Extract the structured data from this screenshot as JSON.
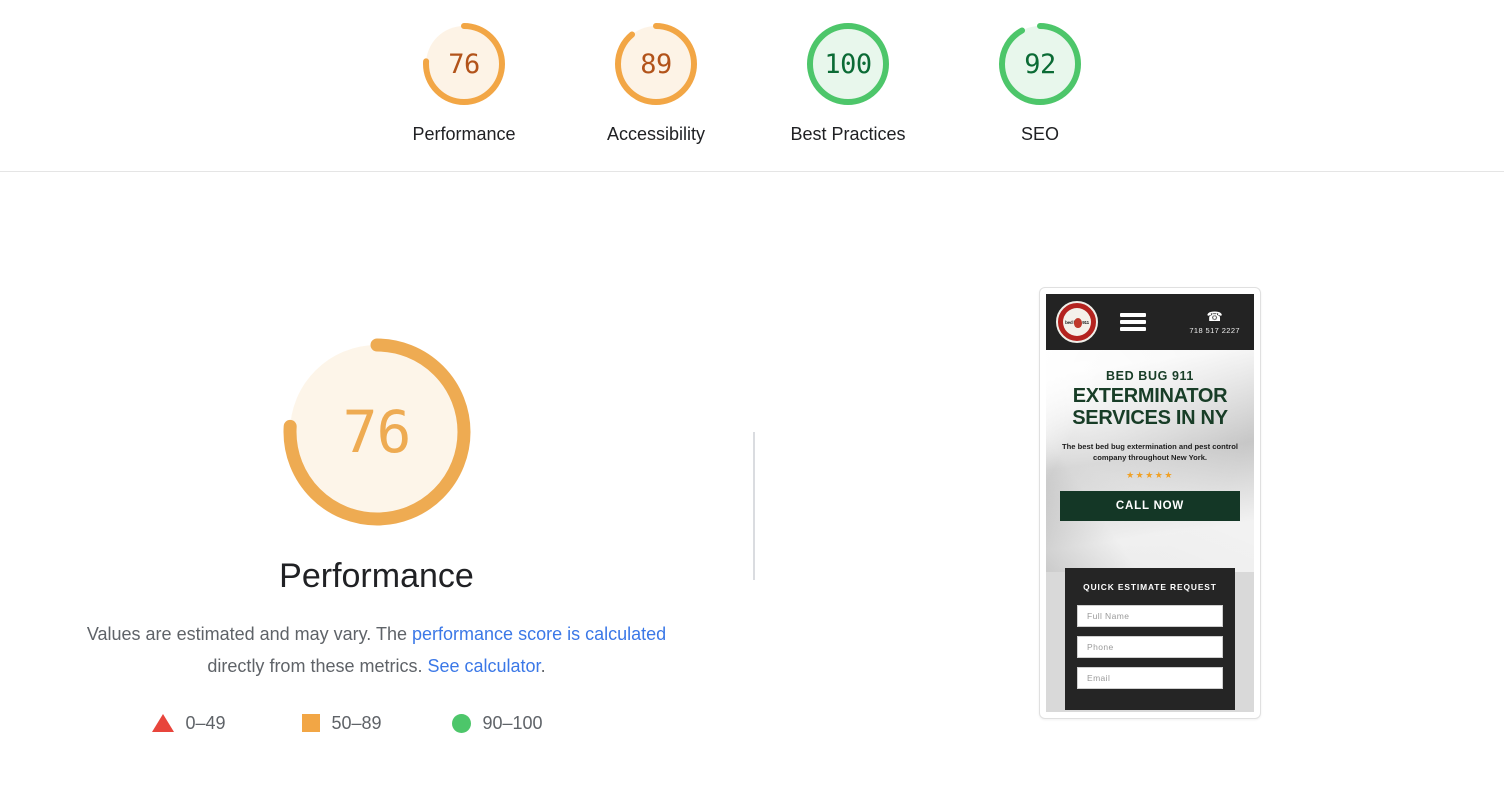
{
  "summary": {
    "gauges": [
      {
        "score": "76",
        "label": "Performance",
        "state": "average",
        "color": "#f2a645",
        "track": "#fdf3e6",
        "pct": 76
      },
      {
        "score": "89",
        "label": "Accessibility",
        "state": "average",
        "color": "#f2a645",
        "track": "#fdf3e6",
        "pct": 89
      },
      {
        "score": "100",
        "label": "Best Practices",
        "state": "pass",
        "color": "#4dc66a",
        "track": "#e8f7ec",
        "pct": 100
      },
      {
        "score": "92",
        "label": "SEO",
        "state": "pass",
        "color": "#4dc66a",
        "track": "#e8f7ec",
        "pct": 92
      }
    ]
  },
  "category": {
    "score": "76",
    "title": "Performance",
    "pct": 76,
    "arc_color": "#eeab52",
    "fill_color": "#fdf5e9",
    "description": {
      "text_before": "Values are estimated and may vary. The ",
      "link1": "performance score is calculated",
      "text_middle": " directly from these metrics. ",
      "link2": "See calculator",
      "text_after": "."
    },
    "legend": [
      {
        "marker": "triangle-marker",
        "range": "0–49",
        "color": "#e8453c"
      },
      {
        "marker": "square-marker",
        "range": "50–89",
        "color": "#f2a645"
      },
      {
        "marker": "circle-marker",
        "range": "90–100",
        "color": "#4dc66a"
      }
    ]
  },
  "screenshot": {
    "site": {
      "logo_text": "bed bug 911",
      "phone_icon": "phone-icon",
      "phone_number": "718 517 2227",
      "hero_kicker": "BED BUG 911",
      "hero_title_line1": "EXTERMINATOR",
      "hero_title_line2": "SERVICES IN NY",
      "hero_sub": "The best bed bug extermination and pest control company throughout New York.",
      "stars": "★★★★★",
      "call_button": "CALL NOW",
      "form_title": "QUICK ESTIMATE REQUEST",
      "fields": [
        {
          "name": "full-name-field",
          "placeholder": "Full Name"
        },
        {
          "name": "phone-field",
          "placeholder": "Phone"
        },
        {
          "name": "email-field",
          "placeholder": "Email"
        }
      ]
    }
  }
}
